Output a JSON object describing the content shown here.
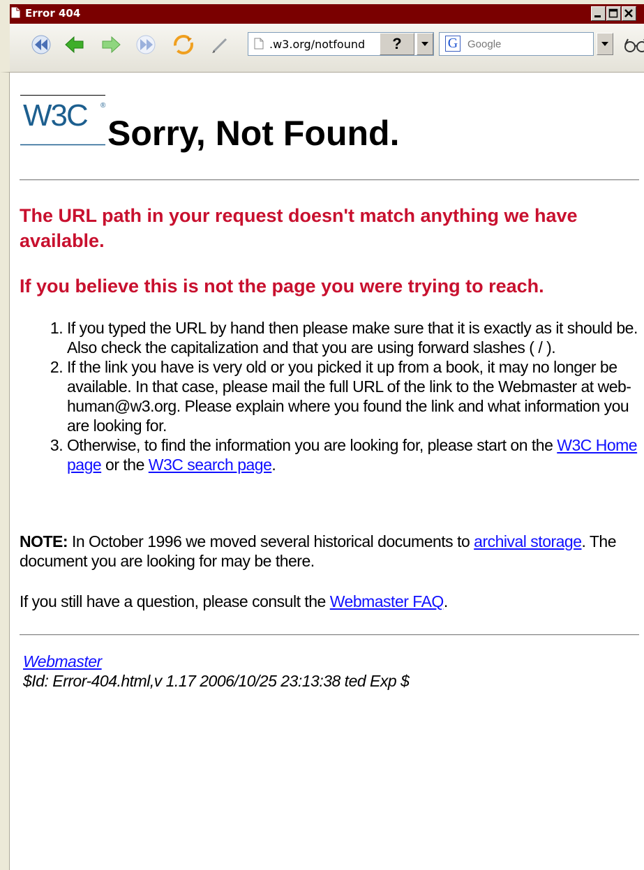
{
  "window": {
    "title": "Error 404"
  },
  "toolbar": {
    "url": ".w3.org/notfound",
    "help_button": "?",
    "search_engine_icon": "G",
    "search_placeholder": "Google",
    "icons": [
      "first-icon",
      "back-icon",
      "forward-icon",
      "last-icon",
      "reload-icon",
      "edit-icon",
      "page-icon",
      "glasses-icon"
    ]
  },
  "page": {
    "logo_text": "W3C",
    "logo_mark": "®",
    "heading": "Sorry, Not Found.",
    "red_msg_1": "The URL path in your request doesn't match anything we have available.",
    "red_msg_2": "If you believe this is not the page you were trying to reach.",
    "steps": {
      "s1": "If you typed the URL by hand then please make sure that it is exactly as it should be. Also check the capitalization and that you are using forward slashes ( / ).",
      "s2": "If the link you have is very old or you picked it up from a book, it may no longer be available. In that case, please mail the full URL of the link to the Webmaster at web-human@w3.org. Please explain where you found the link and what information you are looking for.",
      "s3_prefix": "Otherwise, to find the information you are looking for, please start on the ",
      "s3_link1": "W3C Home page",
      "s3_mid": " or the ",
      "s3_link2": "W3C search page",
      "s3_suffix": "."
    },
    "note": {
      "label": "NOTE:",
      "text": " In October 1996 we moved several historical documents to ",
      "link": "archival storage",
      "suffix": ". The document you are looking for may be there."
    },
    "faq": {
      "text": "If you still have a question, please consult the ",
      "link": "Webmaster FAQ",
      "suffix": "."
    },
    "footer": {
      "webmaster_link": "Webmaster",
      "revision": "$Id: Error-404.html,v 1.17 2006/10/25 23:13:38 ted Exp $"
    }
  },
  "colors": {
    "titlebar": "#7a0000",
    "heading_red": "#c8102e",
    "link": "#1010ff",
    "logo_blue": "#1d5f8f"
  }
}
